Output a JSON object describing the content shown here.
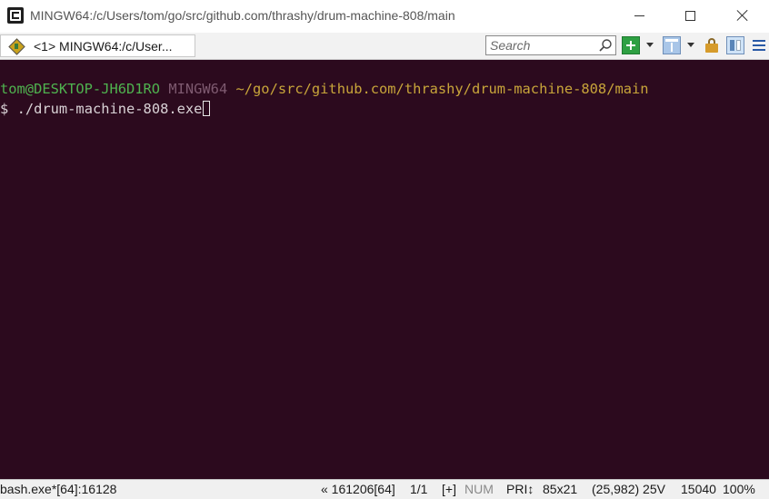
{
  "window": {
    "title": "MINGW64:/c/Users/tom/go/src/github.com/thrashy/drum-machine-808/main"
  },
  "tab": {
    "label": "<1> MINGW64:/c/User..."
  },
  "toolbar": {
    "search_placeholder": "Search"
  },
  "terminal": {
    "prompt_user": "tom@DESKTOP-JH6D1RO",
    "prompt_host": "MINGW64",
    "prompt_path": "~/go/src/github.com/thrashy/drum-machine-808/main",
    "prompt_symbol": "$",
    "command": "./drum-machine-808.exe"
  },
  "status": {
    "process": "bash.exe*[64]:16128",
    "buffer": "« 161206[64]",
    "console_index": "1/1",
    "plus": "[+]",
    "num": "NUM",
    "priority": "PRI↕",
    "size": "85x21",
    "cursor_pos": "(25,982) 25V",
    "pid": "15040",
    "zoom": "100%"
  },
  "colors": {
    "terminal_bg": "#2c0a1e",
    "prompt_user": "#4fb34f",
    "prompt_host": "#7e5a70",
    "prompt_path": "#c8a53a"
  }
}
